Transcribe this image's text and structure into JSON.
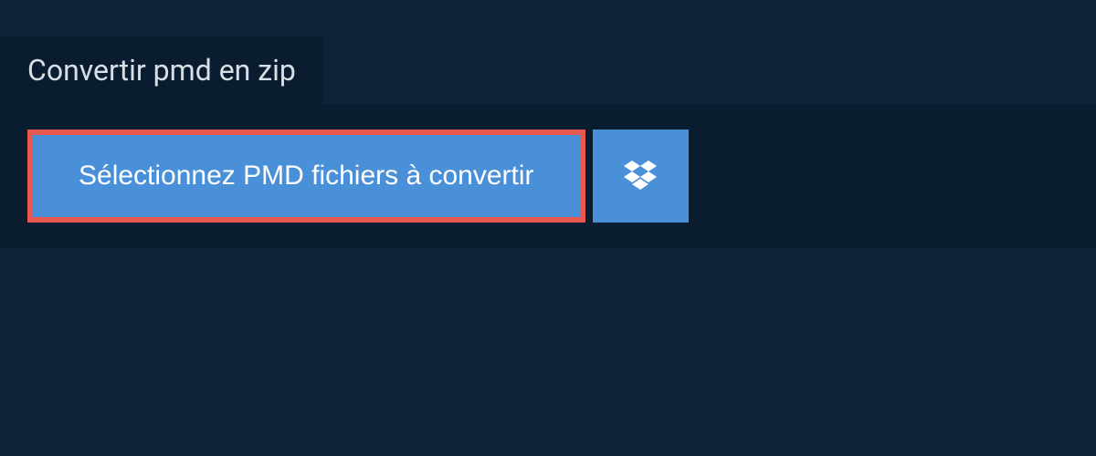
{
  "tab": {
    "label": "Convertir pmd en zip"
  },
  "buttons": {
    "select_files_label": "Sélectionnez PMD fichiers à convertir"
  },
  "colors": {
    "background": "#0d2438",
    "panel": "#0a1d30",
    "button": "#4a90d9",
    "highlight_border": "#e85a4f"
  }
}
